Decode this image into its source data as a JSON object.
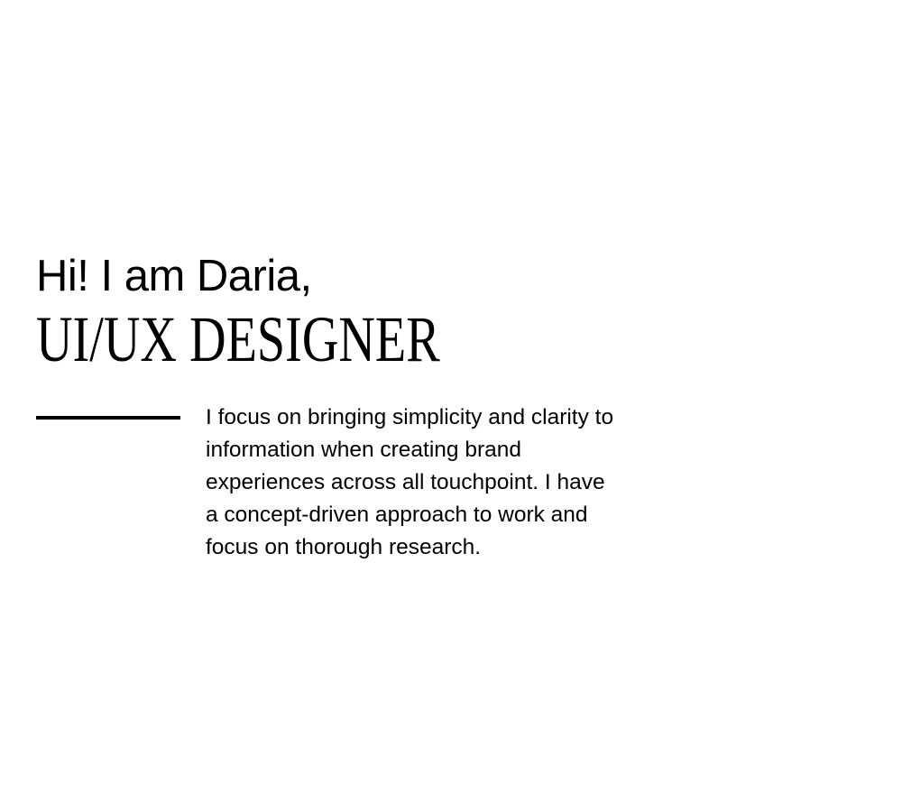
{
  "hero": {
    "greeting": "Hi! I am Daria,",
    "role": "UI/UX DESIGNER",
    "bio_lines": [
      "I focus on bringing simplicity and clarity to",
      "information when creating brand",
      "experiences across all touchpoint. I have",
      "a concept-driven approach to work and",
      "focus on thorough research."
    ]
  }
}
